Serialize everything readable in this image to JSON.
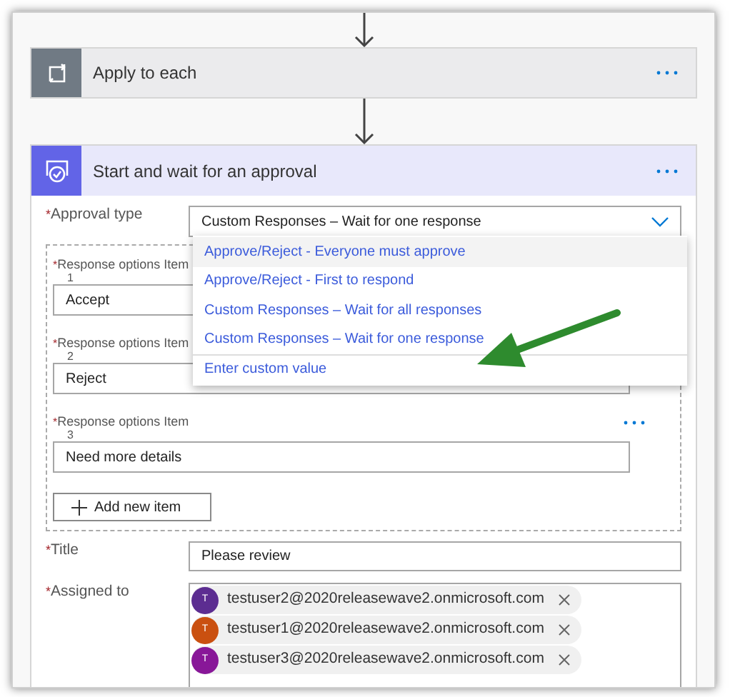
{
  "apply_step": {
    "title": "Apply to each"
  },
  "approval_step": {
    "title": "Start and wait for an approval",
    "approval_type": {
      "marker": "*",
      "label": "Approval type",
      "value": "Custom Responses – Wait for one response"
    },
    "dropdown_options": [
      {
        "label": "Approve/Reject - Everyone must approve",
        "hovered": true
      },
      {
        "label": "Approve/Reject - First to respond",
        "hovered": false
      },
      {
        "label": "Custom Responses – Wait for all responses",
        "hovered": false
      },
      {
        "label": "Custom Responses – Wait for one response",
        "hovered": false
      },
      {
        "label": "Enter custom value",
        "hovered": false
      }
    ],
    "response_options": [
      {
        "marker": "*",
        "label": "Response options Item",
        "number": "1",
        "value": "Accept"
      },
      {
        "marker": "*",
        "label": "Response options Item",
        "number": "2",
        "value": "Reject"
      },
      {
        "marker": "*",
        "label": "Response options Item",
        "number": "3",
        "value": "Need more details"
      }
    ],
    "add_button": "Add new item",
    "title_field": {
      "marker": "*",
      "label": "Title",
      "value": "Please review"
    },
    "assigned_to": {
      "marker": "*",
      "label": "Assigned to",
      "people": [
        {
          "initial": "T",
          "email": "testuser2@2020releasewave2.onmicrosoft.com",
          "color": "#5c2d91"
        },
        {
          "initial": "T",
          "email": "testuser1@2020releasewave2.onmicrosoft.com",
          "color": "#ca5010"
        },
        {
          "initial": "T",
          "email": "testuser3@2020releasewave2.onmicrosoft.com",
          "color": "#881798"
        }
      ]
    }
  }
}
